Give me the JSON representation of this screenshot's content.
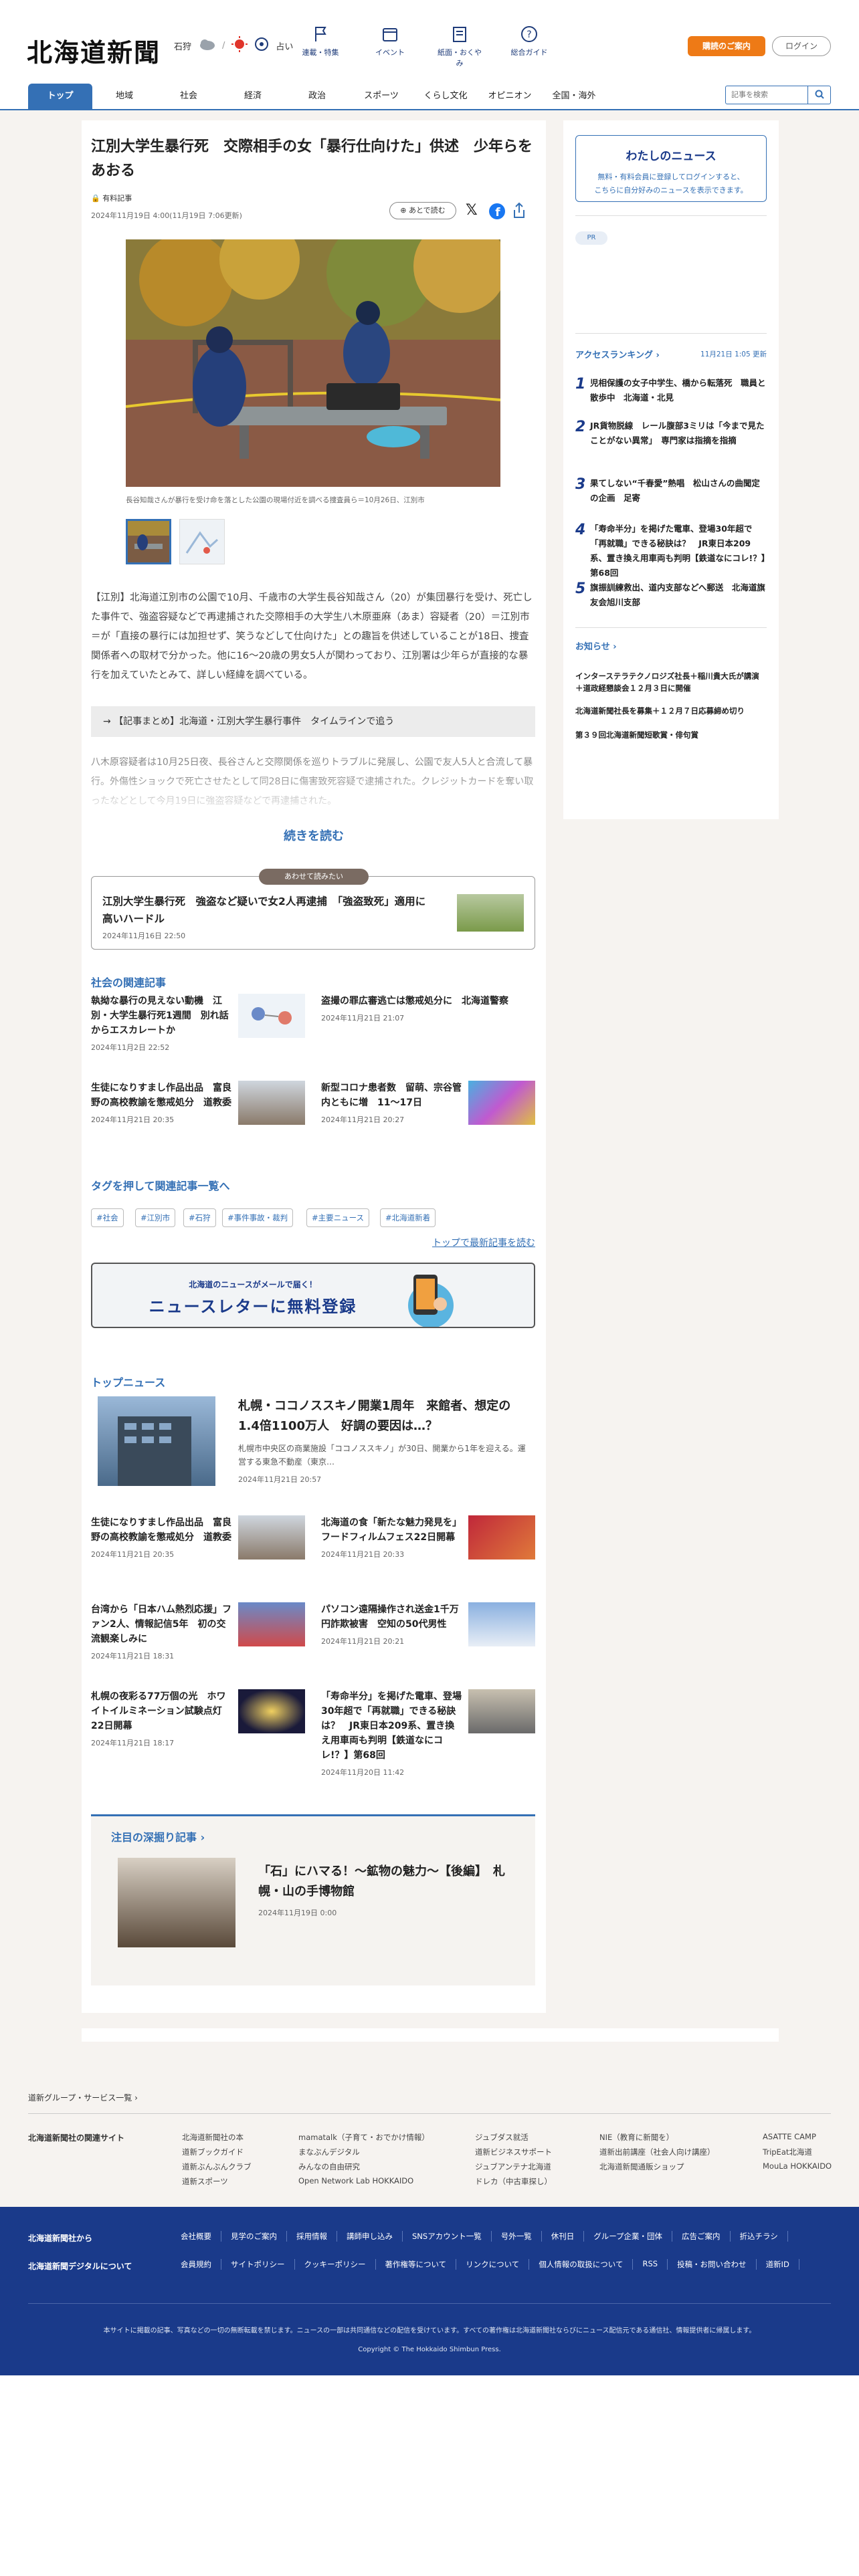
{
  "header": {
    "logo": "北海道新聞",
    "area": "石狩",
    "fortune": "占い",
    "nav": [
      {
        "label": "連載・特集",
        "icon": "flag-icon"
      },
      {
        "label": "イベント",
        "icon": "calendar-icon"
      },
      {
        "label": "紙面・おくやみ",
        "icon": "newspaper-icon"
      },
      {
        "label": "総合ガイド",
        "icon": "question-icon"
      }
    ],
    "subscribe": "購読のご案内",
    "login": "ログイン"
  },
  "menu": {
    "items": [
      "トップ",
      "地域",
      "社会",
      "経済",
      "政治",
      "スポーツ",
      "くらし文化",
      "オピニオン",
      "全国・海外"
    ],
    "search_placeholder": "記事を検索"
  },
  "article": {
    "title": "江別大学生暴行死　交際相手の女「暴行仕向けた」供述　少年らをあおる",
    "paid": "有料記事",
    "date": "2024年11月19日 4:00(11月19日 7:06更新)",
    "listen": "あとで読む",
    "caption": "長谷知哉さんが暴行を受け命を落とした公園の現場付近を調べる捜査員ら＝10月26日、江別市",
    "body": "【江別】北海道江別市の公園で10月、千歳市の大学生長谷知哉さん（20）が集団暴行を受け、死亡した事件で、強盗容疑などで再逮捕された交際相手の大学生八木原亜麻（あま）容疑者（20）＝江別市＝が「直接の暴行には加担せず、笑うなどして仕向けた」との趣旨を供述していることが18日、捜査関係者への取材で分かった。他に16～20歳の男女5人が関わっており、江別署は少年らが直接的な暴行を加えていたとみて、詳しい経緯を調べている。",
    "related": "【記事まとめ】北海道・江別大学生暴行事件　タイムラインで追う",
    "faded": "八木原容疑者は10月25日夜、長谷さんと交際関係を巡りトラブルに発展し、公園で友人5人と合流して暴行。外傷性ショックで死亡させたとして同28日に傷害致死容疑で逮捕された。クレジットカードを奪い取ったなどとして今月19日に強盗容疑などで再逮捕された。",
    "read_more": "続きを読む"
  },
  "awase": {
    "tag": "あわせて読みたい",
    "title": "江別大学生暴行死　強盗など疑いで女2人再逮捕　「強盗致死」適用に高いハードル",
    "date": "2024年11月16日 22:50"
  },
  "social": {
    "heading": "社会の関連記事",
    "items": [
      {
        "title": "執拗な暴行の見えない動機　江別・大学生暴行死1週間　別れ話からエスカレートか",
        "date": "2024年11月2日 22:52"
      },
      {
        "title": "盗撮の罪広審逃亡は懲戒処分に　北海道警察",
        "date": "2024年11月21日 21:07"
      },
      {
        "title": "生徒になりすまし作品出品　富良野の高校教諭を懲戒処分　道教委",
        "date": "2024年11月21日 20:35"
      },
      {
        "title": "新型コロナ患者数　留萌、宗谷管内ともに増　11～17日",
        "date": "2024年11月21日 20:27"
      }
    ]
  },
  "tags": {
    "heading": "タグを押して関連記事一覧へ",
    "items": [
      "#社会",
      "#江別市",
      "#石狩",
      "#事件事故・裁判",
      "#主要ニュース",
      "#北海道新着"
    ],
    "latest": "トップで最新記事を読む"
  },
  "newsletter": {
    "small": "北海道のニュースがメールで届く！",
    "big": "ニュースレターに無料登録"
  },
  "top": {
    "heading": "トップニュース",
    "lead": {
      "title": "札幌・ココノススキノ開業1周年　来館者、想定の1.4倍1100万人　好調の要因は…？",
      "summary": "札幌市中央区の商業施設「ココノススキノ」が30日、開業から1年を迎える。運営する東急不動産（東京…",
      "date": "2024年11月21日 20:57"
    },
    "items": [
      {
        "title": "生徒になりすまし作品出品　富良野の高校教諭を懲戒処分　道教委",
        "date": "2024年11月21日 20:35"
      },
      {
        "title": "北海道の食「新たな魅力発見を」　フードフィルムフェス22日開幕",
        "date": "2024年11月21日 20:33"
      },
      {
        "title": "台湾から「日本ハム熱烈応援」ファン2人、情報記信5年　初の交流観楽しみに",
        "date": "2024年11月21日 18:31"
      },
      {
        "title": "パソコン遠隔操作され送金1千万円詐欺被害　空知の50代男性",
        "date": "2024年11月21日 20:21"
      },
      {
        "title": "札幌の夜彩る77万個の光　ホワイトイルミネーション試験点灯　22日開幕",
        "date": "2024年11月21日 18:17"
      },
      {
        "title": "「寿命半分」を掲げた電車、登場30年超で「再就職」できる秘訣は？　JR東日本209系、置き換え用車両も判明【鉄道なにコレ!？】第68回",
        "date": "2024年11月20日 11:42"
      }
    ]
  },
  "deep": {
    "heading": "注目の深掘り記事",
    "title": "「石」にハマる！～鉱物の魅力～【後編】　札幌・山の手博物館",
    "date": "2024年11月19日 0:00"
  },
  "side": {
    "mynews_title": "わたしのニュース",
    "mynews_text1": "無料・有料会員に登録してログインすると、",
    "mynews_text2": "こちらに自分好みのニュースを表示できます。",
    "pr": "PR",
    "ranking_title": "アクセスランキング",
    "ranking_time": "11月21日 1:05 更新",
    "ranking": [
      "児相保護の女子中学生、橋から転落死　職員と散歩中　北海道・北見",
      "JR貨物脱線　レール腹部3ミリは「今まで見たことがない異常」　専門家は指摘を指摘",
      "果てしない“千春愛”熱唱　松山さんの曲聞定の企画　足寄",
      "「寿命半分」を掲げた電車、登場30年超で「再就職」できる秘訣は？　JR東日本209系、置き換え用車両も判明【鉄道なにコレ!？】第68回",
      "旗振訓練救出、道内支部などへ郵送　北海道旗友会旭川支部"
    ],
    "notice_title": "お知らせ",
    "notices": [
      "インターステラテクノロジズ社長＋稲川貴大氏が講演＋道政経懇談会１２月３日に開催",
      "北海道新聞社長を募集＋１２月７日応募締め切り",
      "第３９回北海道新聞短歌賞・俳句賞"
    ]
  },
  "footer": {
    "group": "道新グループ・サービス一覧",
    "related_site": "北海道新聞社の関連サイト",
    "cols": [
      [
        "北海道新聞社の本",
        "道新ブックガイド",
        "道新ぶんぶんクラブ",
        "道新スポーツ"
      ],
      [
        "mamatalk（子育て・おでかけ情報）",
        "まなぶんデジタル",
        "みんなの自由研究",
        "Open Network Lab HOKKAIDO"
      ],
      [
        "ジュブダス就活",
        "道新ビジネスサポート",
        "ジュブアンテナ北海道",
        "ドレカ（中古車探し）"
      ],
      [
        "NIE（教育に新聞を）",
        "道新出前講座（社会人向け講座）",
        "北海道新聞通販ショップ"
      ],
      [
        "ASATTE CAMP",
        "TripEat北海道",
        "MouLa HOKKAIDO"
      ]
    ],
    "blue_h1": "北海道新聞社から",
    "blue_h2": "北海道新聞デジタルについて",
    "links1": [
      "会社概要",
      "見学のご案内",
      "採用情報",
      "講師申し込み",
      "SNSアカウント一覧",
      "号外一覧",
      "休刊日",
      "グループ企業・団体",
      "広告ご案内",
      "折込チラシ"
    ],
    "links2": [
      "会員規約",
      "サイトポリシー",
      "クッキーポリシー",
      "著作権等について",
      "リンクについて",
      "個人情報の取扱について",
      "RSS",
      "投稿・お問い合わせ",
      "道新ID"
    ],
    "note": "本サイトに掲載の記事、写真などの一切の無断転載を禁じます。ニュースの一部は共同通信などの配信を受けています。すべての著作権は北海道新聞社ならびにニュース配信元である通信社、情報提供者に帰属します。",
    "copyright": "Copyright © The Hokkaido Shimbun Press."
  },
  "colors": {
    "accent": "#3470b5",
    "brand_orange": "#ee7a16",
    "footer_blue": "#1a3a8a"
  }
}
